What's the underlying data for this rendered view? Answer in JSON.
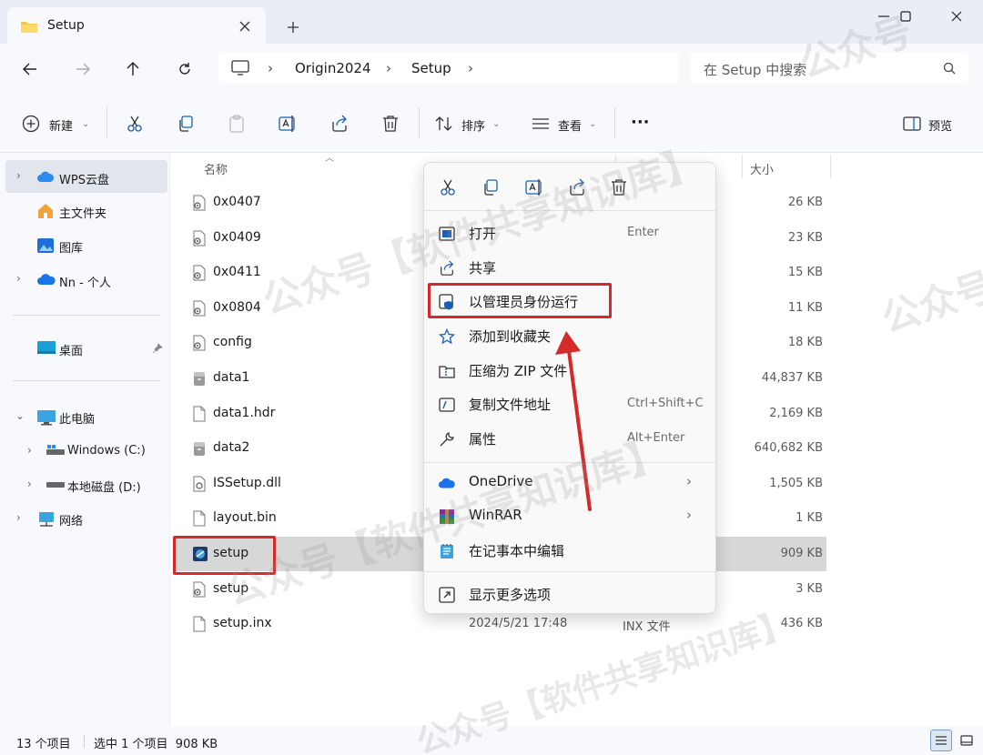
{
  "window": {
    "tab_title": "Setup",
    "new_tab_label": "+",
    "minimize_glyph": "—",
    "maximize_glyph": "☐",
    "close_glyph": "✕"
  },
  "address": {
    "crumbs": [
      "Origin2024",
      "Setup"
    ],
    "separator": "›",
    "search_placeholder": "在 Setup 中搜索"
  },
  "toolbar": {
    "new_label": "新建",
    "sort_label": "排序",
    "view_label": "查看",
    "more_label": "···",
    "preview_label": "预览"
  },
  "sidebar": {
    "items": [
      {
        "label": "WPS云盘",
        "icon": "cloud-icon",
        "expander": "›"
      },
      {
        "label": "主文件夹",
        "icon": "home-icon"
      },
      {
        "label": "图库",
        "icon": "gallery-icon"
      },
      {
        "label": "Nn - 个人",
        "icon": "onedrive-icon",
        "expander": "›"
      },
      {
        "label": "桌面",
        "icon": "desktop-icon",
        "pin": "📌"
      },
      {
        "label": "此电脑",
        "icon": "pc-icon",
        "expander": "⌄"
      },
      {
        "label": "Windows (C:)",
        "icon": "drive-icon",
        "expander": "›"
      },
      {
        "label": "本地磁盘 (D:)",
        "icon": "drive-icon",
        "expander": "›"
      },
      {
        "label": "网络",
        "icon": "network-icon",
        "expander": "›"
      }
    ]
  },
  "filelist": {
    "col_name": "名称",
    "col_size": "大小",
    "files": [
      {
        "name": "0x0407",
        "date": "",
        "type": "",
        "size": "26 KB",
        "icon": "settings-file-icon"
      },
      {
        "name": "0x0409",
        "date": "",
        "type": "",
        "size": "23 KB",
        "icon": "settings-file-icon"
      },
      {
        "name": "0x0411",
        "date": "",
        "type": "",
        "size": "15 KB",
        "icon": "settings-file-icon"
      },
      {
        "name": "0x0804",
        "date": "",
        "type": "",
        "size": "11 KB",
        "icon": "settings-file-icon"
      },
      {
        "name": "config",
        "date": "",
        "type": "",
        "size": "18 KB",
        "icon": "settings-file-icon"
      },
      {
        "name": "data1",
        "date": "",
        "type": "",
        "size": "44,837 KB",
        "icon": "cab-file-icon"
      },
      {
        "name": "data1.hdr",
        "date": "",
        "type": "",
        "size": "2,169 KB",
        "icon": "blank-file-icon"
      },
      {
        "name": "data2",
        "date": "",
        "type": "",
        "size": "640,682 KB",
        "icon": "cab-file-icon"
      },
      {
        "name": "ISSetup.dll",
        "date": "",
        "type": "",
        "size": "1,505 KB",
        "icon": "dll-file-icon"
      },
      {
        "name": "layout.bin",
        "date": "",
        "type": "",
        "size": "1 KB",
        "icon": "blank-file-icon"
      },
      {
        "name": "setup",
        "date": "",
        "type": "",
        "size": "909 KB",
        "icon": "setup-exe-icon"
      },
      {
        "name": "setup",
        "date": "",
        "type": "",
        "size": "3 KB",
        "icon": "settings-file-icon"
      },
      {
        "name": "setup.inx",
        "date": "2024/5/21 17:48",
        "type": "INX 文件",
        "size": "436 KB",
        "icon": "blank-file-icon"
      }
    ]
  },
  "context_menu": {
    "items": [
      {
        "label": "打开",
        "shortcut": "Enter",
        "icon": "open-icon"
      },
      {
        "label": "共享",
        "shortcut": "",
        "icon": "share-icon"
      },
      {
        "label": "以管理员身份运行",
        "shortcut": "",
        "icon": "shield-icon"
      },
      {
        "label": "添加到收藏夹",
        "shortcut": "",
        "icon": "star-icon"
      },
      {
        "label": "压缩为 ZIP 文件",
        "shortcut": "",
        "icon": "zip-icon"
      },
      {
        "label": "复制文件地址",
        "shortcut": "Ctrl+Shift+C",
        "icon": "copy-path-icon"
      },
      {
        "label": "属性",
        "shortcut": "Alt+Enter",
        "icon": "wrench-icon"
      },
      {
        "label": "OneDrive",
        "shortcut": "",
        "icon": "onedrive-icon"
      },
      {
        "label": "WinRAR",
        "shortcut": "",
        "icon": "winrar-icon"
      },
      {
        "label": "在记事本中编辑",
        "shortcut": "",
        "icon": "notepad-icon"
      },
      {
        "label": "显示更多选项",
        "shortcut": "",
        "icon": "more-options-icon"
      }
    ],
    "submenu_arrow": "›"
  },
  "status": {
    "count": "13 个项目",
    "selection": "选中 1 个项目  908 KB"
  },
  "watermark": {
    "text1": "公众号【软件共享知识库】",
    "text2": "公众号"
  },
  "colors": {
    "annotation_red": "#d42a2a",
    "accent_blue": "#0067c0",
    "selection_gray": "#d7d7d7"
  }
}
